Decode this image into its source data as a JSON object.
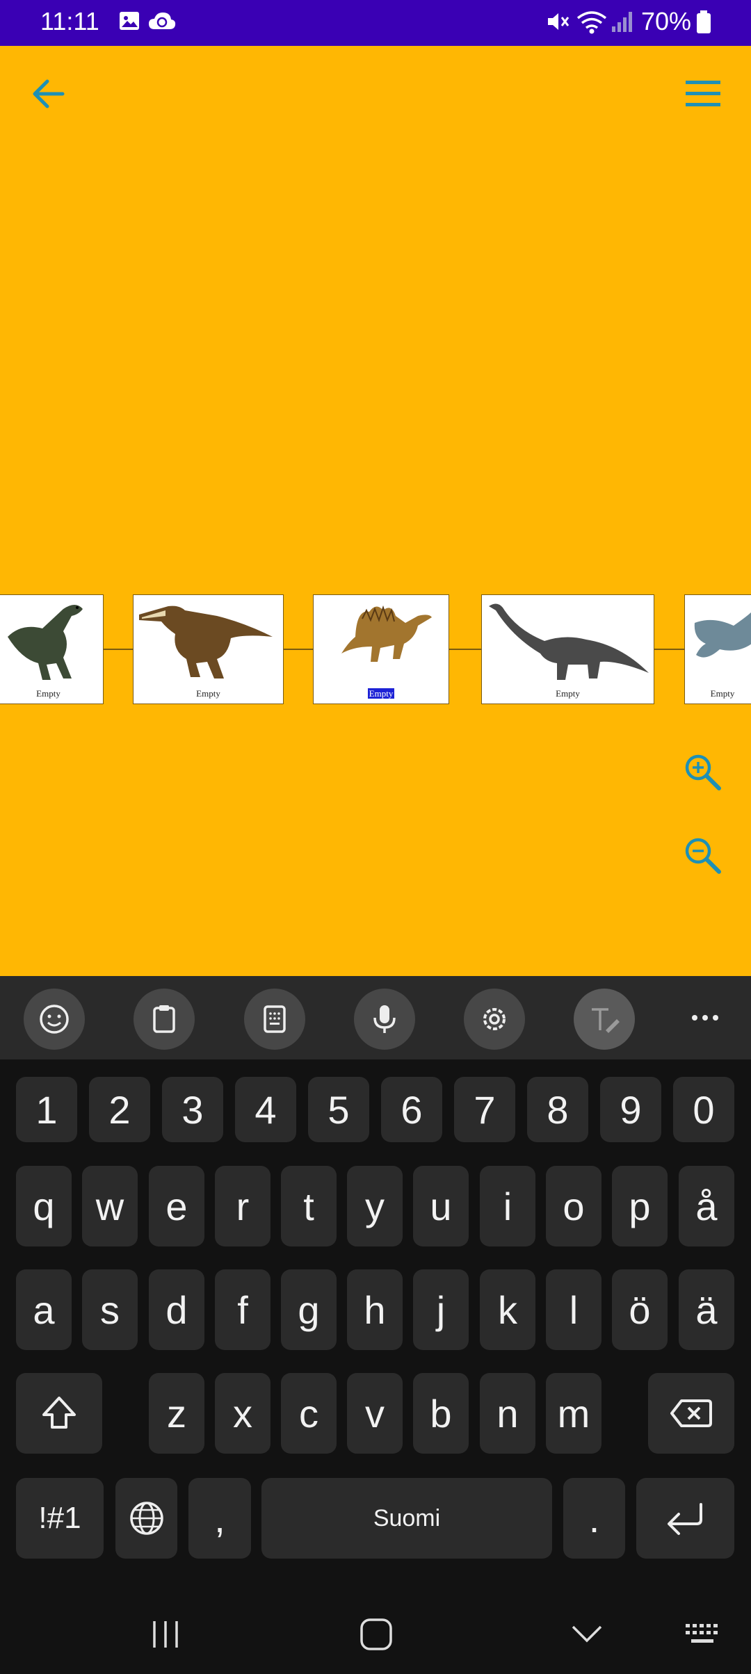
{
  "status_bar": {
    "time": "11:11",
    "battery": "70%",
    "icons": [
      "image-icon",
      "cloud-sync-icon",
      "mute-icon",
      "wifi-icon",
      "signal-icon",
      "battery-icon"
    ]
  },
  "header": {
    "back_icon": "arrow-left-icon",
    "menu_icon": "hamburger-menu-icon",
    "accent_color": "#1E90B5"
  },
  "timeline": {
    "background_color": "#FFB703",
    "cards": [
      {
        "label": "Empty",
        "image": "velociraptor-dinosaur",
        "selected": false
      },
      {
        "label": "Empty",
        "image": "baryonyx-dinosaur",
        "selected": false
      },
      {
        "label": "Empty",
        "image": "spinosaurus-dinosaur",
        "selected": true
      },
      {
        "label": "Empty",
        "image": "sauropod-dinosaur",
        "selected": false
      },
      {
        "label": "Empty",
        "image": "plesiosaur-marine-reptile",
        "selected": false
      }
    ]
  },
  "zoom": {
    "in_icon": "zoom-in-icon",
    "out_icon": "zoom-out-icon"
  },
  "keyboard_toolbar": {
    "items": [
      "emoji-icon",
      "clipboard-icon",
      "one-handed-keypad-icon",
      "microphone-icon",
      "settings-icon",
      "handwriting-icon",
      "more-icon"
    ]
  },
  "keyboard": {
    "number_row": [
      "1",
      "2",
      "3",
      "4",
      "5",
      "6",
      "7",
      "8",
      "9",
      "0"
    ],
    "row1": [
      "q",
      "w",
      "e",
      "r",
      "t",
      "y",
      "u",
      "i",
      "o",
      "p",
      "å"
    ],
    "row2": [
      "a",
      "s",
      "d",
      "f",
      "g",
      "h",
      "j",
      "k",
      "l",
      "ö",
      "ä"
    ],
    "row3": [
      "z",
      "x",
      "c",
      "v",
      "b",
      "n",
      "m"
    ],
    "symbols_key": "!#1",
    "comma_key": ",",
    "space_label": "Suomi",
    "period_key": "."
  },
  "nav_bar": {
    "items": [
      "recent-apps-icon",
      "home-icon",
      "hide-keyboard-icon",
      "keyboard-switch-icon"
    ]
  }
}
